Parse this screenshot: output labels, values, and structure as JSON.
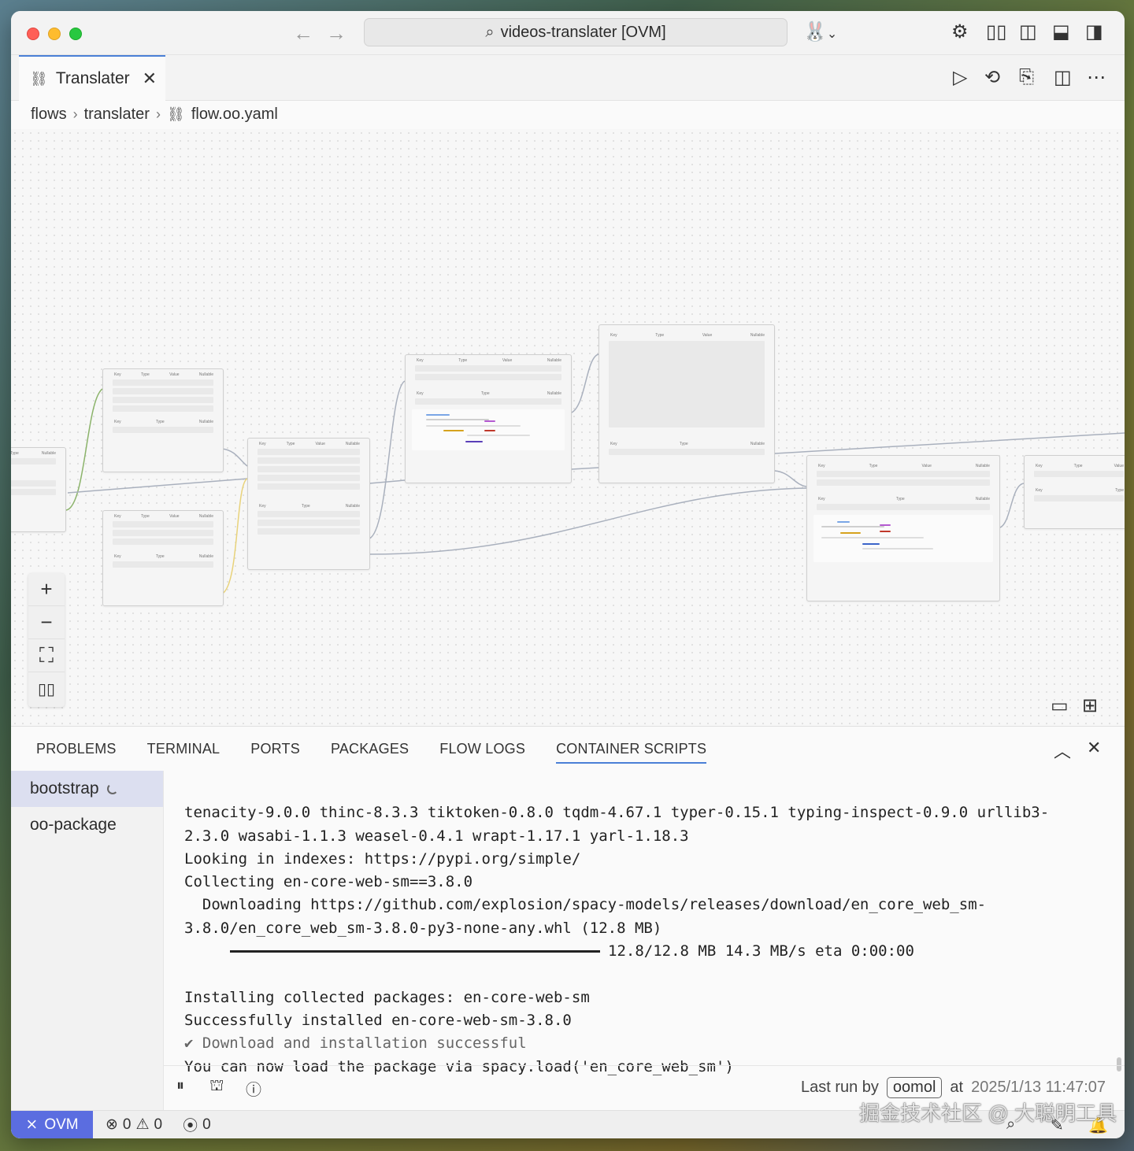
{
  "titlebar": {
    "command_center": "videos-translater [OVM]"
  },
  "tab": {
    "label": "Translater",
    "close": "✕"
  },
  "breadcrumb": {
    "items": [
      "flows",
      "translater",
      "flow.oo.yaml"
    ]
  },
  "nodes": {
    "header_key": "Key",
    "header_type": "Type",
    "header_value": "Value",
    "header_nullable": "Nullable"
  },
  "panel": {
    "tabs": [
      "PROBLEMS",
      "TERMINAL",
      "PORTS",
      "PACKAGES",
      "FLOW LOGS",
      "CONTAINER SCRIPTS"
    ],
    "active_tab": "CONTAINER SCRIPTS",
    "scripts": [
      "bootstrap",
      "oo-package"
    ],
    "log_lines": [
      "tenacity-9.0.0 thinc-8.3.3 tiktoken-0.8.0 tqdm-4.67.1 typer-0.15.1 typing-inspect-0.9.0 urllib3-",
      "2.3.0 wasabi-1.1.3 weasel-0.4.1 wrapt-1.17.1 yarl-1.18.3",
      "Looking in indexes: https://pypi.org/simple/",
      "Collecting en-core-web-sm==3.8.0",
      "  Downloading https://github.com/explosion/spacy-models/releases/download/en_core_web_sm-",
      "3.8.0/en_core_web_sm-3.8.0-py3-none-any.whl (12.8 MB)",
      "12.8/12.8 MB 14.3 MB/s eta 0:00:00",
      "",
      "Installing collected packages: en-core-web-sm",
      "Successfully installed en-core-web-sm-3.8.0",
      "✔ Download and installation successful",
      "You can now load the package via spacy.load('en_core_web_sm')"
    ],
    "download_progress": 1.0,
    "last_run_label": "Last run by",
    "user": "oomol",
    "at_label": "at",
    "timestamp": "2025/1/13 11:47:07"
  },
  "statusbar": {
    "remote": "OVM",
    "errors": "0",
    "warnings": "0",
    "ports": "0"
  },
  "watermark": "掘金技术社区 @ 大聪明工具",
  "colors": {
    "accent": "#4a7fd6",
    "remote_bg": "#5b6de0",
    "edge_green": "#8bb36a",
    "edge_yellow": "#e8d27a",
    "edge_gray": "#a9b0bd"
  }
}
